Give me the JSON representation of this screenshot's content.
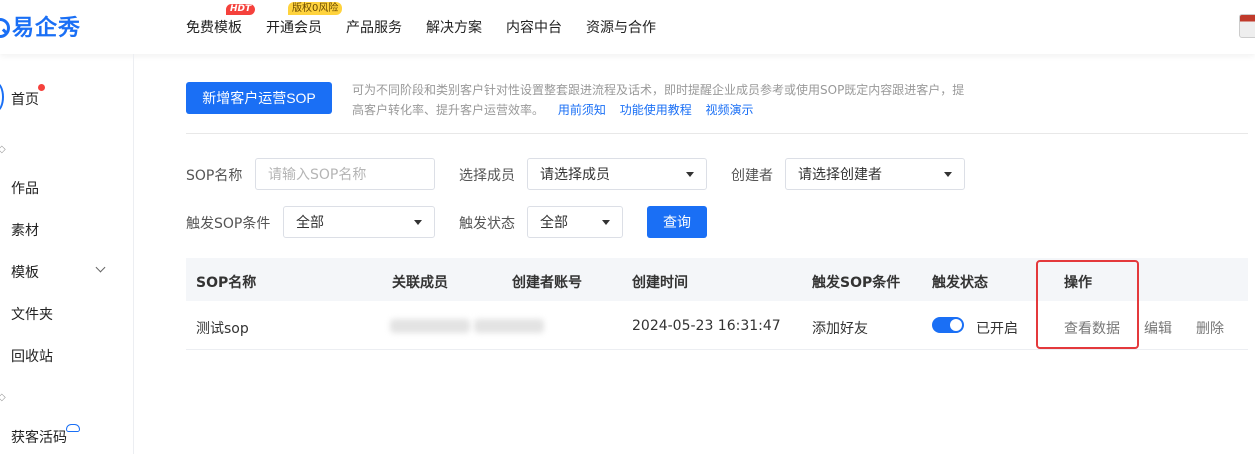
{
  "brand": {
    "name": "易企秀"
  },
  "nav": {
    "items": [
      {
        "label": "免费模板",
        "badge": "HDT"
      },
      {
        "label": "开通会员",
        "badge": "版权0风险"
      },
      {
        "label": "产品服务"
      },
      {
        "label": "解决方案"
      },
      {
        "label": "内容中台"
      },
      {
        "label": "资源与合作"
      }
    ]
  },
  "sidebar": {
    "items": [
      "首页",
      "作品",
      "素材",
      "模板",
      "文件夹",
      "回收站",
      "获客活码"
    ]
  },
  "main": {
    "add_button": "新增客户运营SOP",
    "description": "可为不同阶段和类别客户针对性设置整套跟进流程及话术，即时提醒企业成员参考或使用SOP既定内容跟进客户，提高客户转化率、提升客户运营效率。",
    "links": [
      "用前须知",
      "功能使用教程",
      "视频演示"
    ]
  },
  "filters": {
    "name_label": "SOP名称",
    "name_placeholder": "请输入SOP名称",
    "member_label": "选择成员",
    "member_value": "请选择成员",
    "creator_label": "创建者",
    "creator_value": "请选择创建者",
    "trigger_label": "触发SOP条件",
    "trigger_value": "全部",
    "status_label": "触发状态",
    "status_value": "全部",
    "query_button": "查询"
  },
  "table": {
    "headers": [
      "SOP名称",
      "关联成员",
      "创建者账号",
      "创建时间",
      "触发SOP条件",
      "触发状态",
      "操作"
    ],
    "rows": [
      {
        "name": "测试sop",
        "created_at": "2024-05-23 16:31:47",
        "trigger": "添加好友",
        "status_on": true,
        "status_text": "已开启",
        "actions": [
          "查看数据",
          "编辑",
          "删除"
        ]
      }
    ]
  },
  "colors": {
    "primary": "#1a6ff5",
    "highlight": "#e4393c",
    "dot": "#f5413c"
  }
}
